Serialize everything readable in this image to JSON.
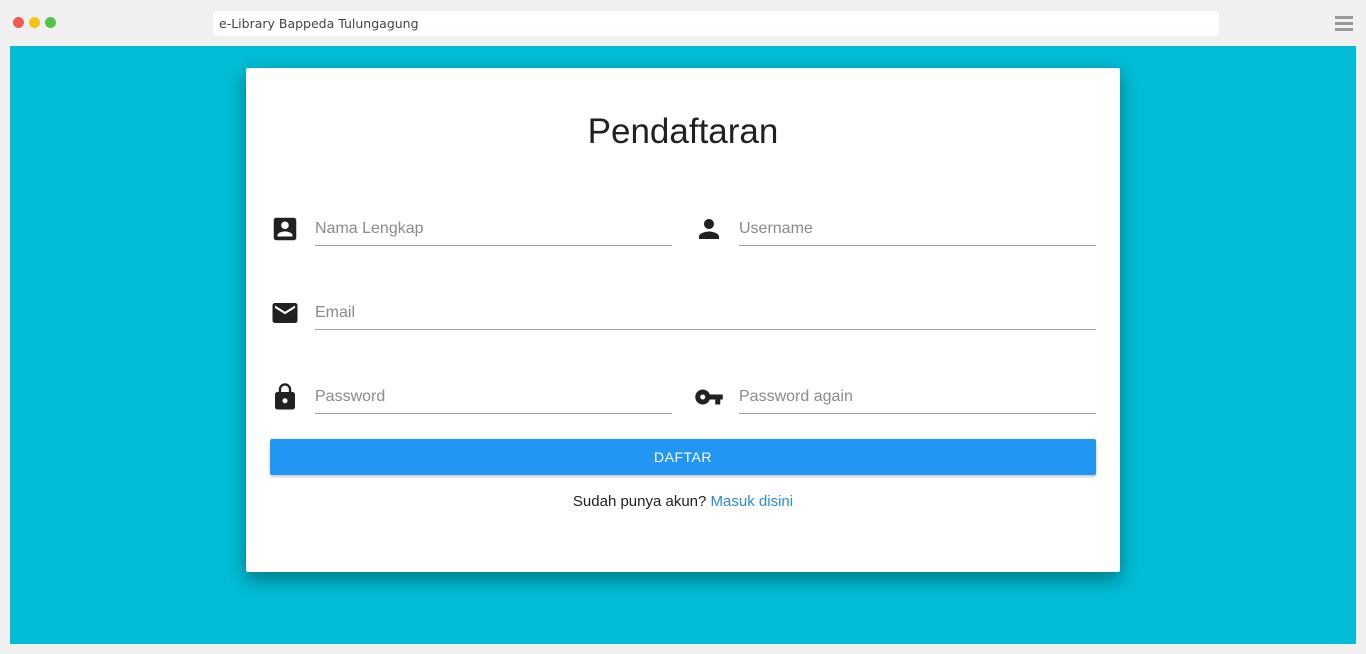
{
  "browser": {
    "address": "e-Library Bappeda Tulungagung"
  },
  "form": {
    "title": "Pendaftaran",
    "fields": {
      "nama": {
        "placeholder": "Nama Lengkap",
        "icon": "account-box-icon"
      },
      "username": {
        "placeholder": "Username",
        "icon": "person-icon"
      },
      "email": {
        "placeholder": "Email",
        "icon": "email-icon"
      },
      "password": {
        "placeholder": "Password",
        "icon": "lock-icon"
      },
      "password_again": {
        "placeholder": "Password again",
        "icon": "key-icon"
      }
    },
    "submit_label": "DAFTAR",
    "login_prompt": "Sudah punya akun?",
    "login_link": "Masuk disini"
  },
  "colors": {
    "background": "#00bcd4",
    "button": "#2196f3",
    "link": "#2a8ad6"
  }
}
